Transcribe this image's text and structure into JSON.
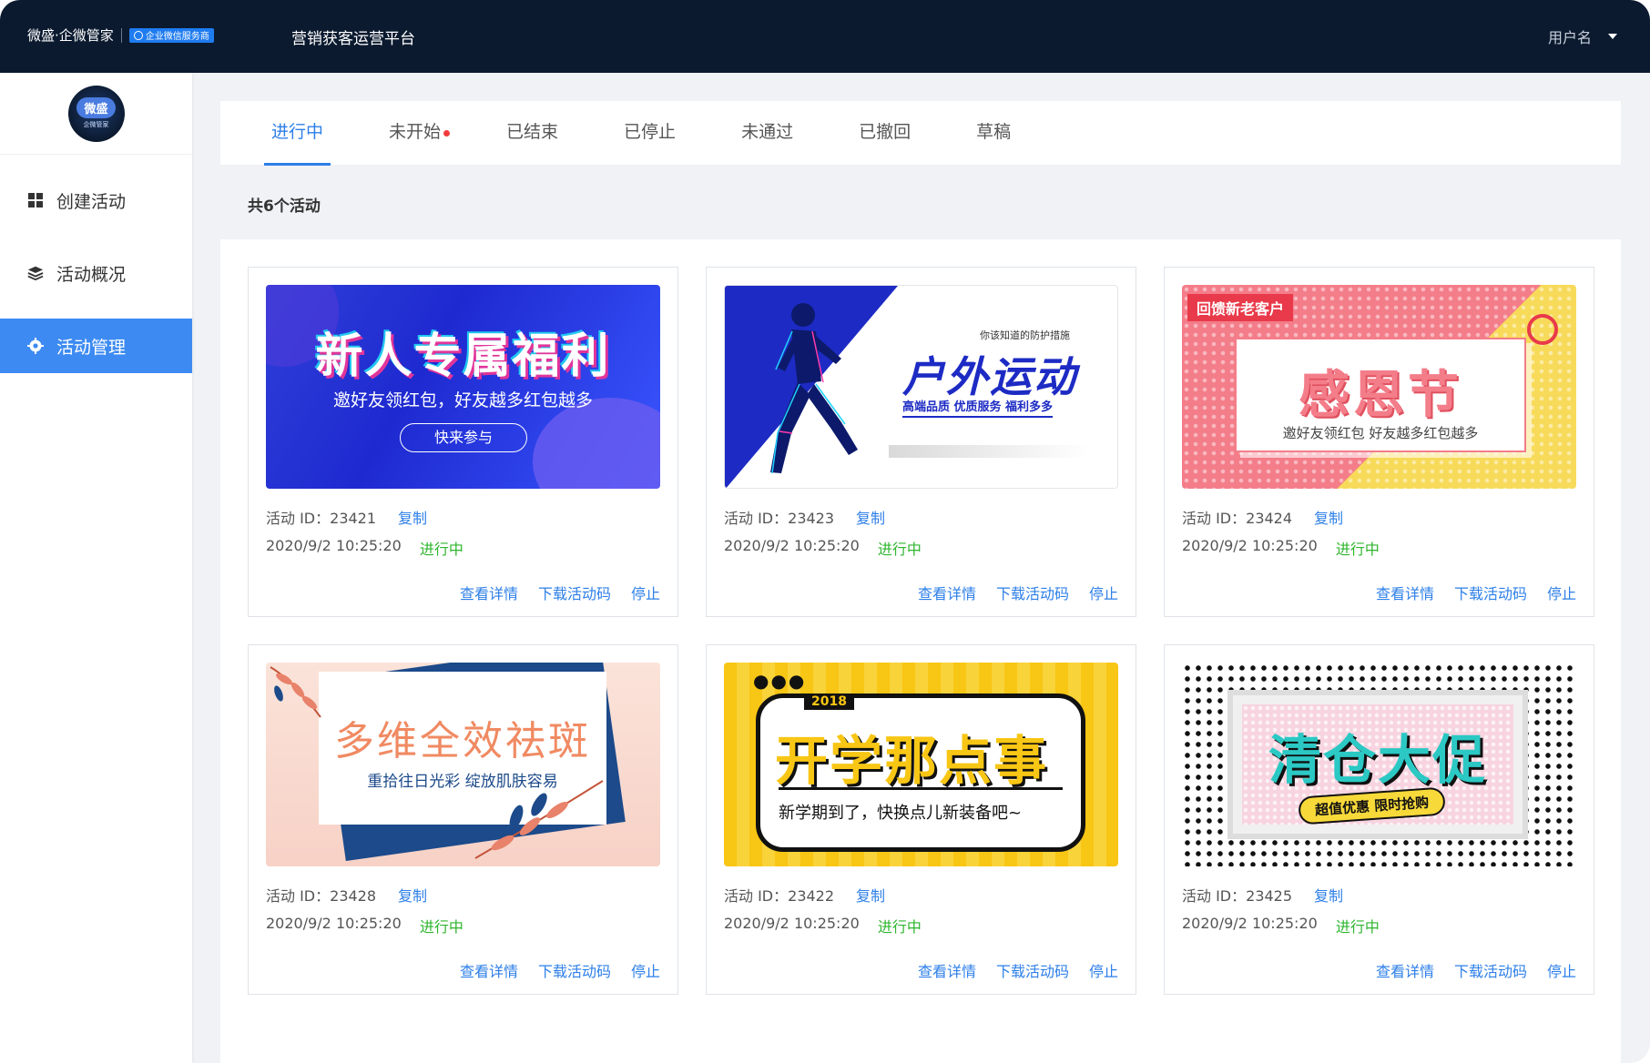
{
  "header": {
    "brand": "微盛·企微管家",
    "badge": "企业微信服务商",
    "platform_title": "营销获客运营平台",
    "user_name": "用户名"
  },
  "sidebar": {
    "logo_text": "微盛",
    "logo_sub": "企微管家",
    "items": [
      {
        "label": "创建活动",
        "icon": "grid-icon",
        "active": false
      },
      {
        "label": "活动概况",
        "icon": "layers-icon",
        "active": false
      },
      {
        "label": "活动管理",
        "icon": "gear-icon",
        "active": true
      }
    ]
  },
  "tabs": [
    {
      "label": "进行中",
      "active": true,
      "dot": false
    },
    {
      "label": "未开始",
      "active": false,
      "dot": true
    },
    {
      "label": "已结束",
      "active": false,
      "dot": false
    },
    {
      "label": "已停止",
      "active": false,
      "dot": false
    },
    {
      "label": "未通过",
      "active": false,
      "dot": false
    },
    {
      "label": "已撤回",
      "active": false,
      "dot": false
    },
    {
      "label": "草稿",
      "active": false,
      "dot": false
    }
  ],
  "summary": "共6个活动",
  "card_labels": {
    "id_prefix": "活动 ID：",
    "copy": "复制",
    "view": "查看详情",
    "download": "下载活动码",
    "stop": "停止"
  },
  "cards": [
    {
      "id": "23421",
      "time": "2020/9/2 10:25:20",
      "status": "进行中",
      "banner": {
        "title": "新人专属福利",
        "subtitle": "邀好友领红包，好友越多红包越多",
        "button": "快来参与"
      }
    },
    {
      "id": "23423",
      "time": "2020/9/2 10:25:20",
      "status": "进行中",
      "banner": {
        "small": "你该知道的防护措施",
        "title": "户外运动",
        "subtitle": "高端品质 优质服务 福利多多"
      }
    },
    {
      "id": "23424",
      "time": "2020/9/2 10:25:20",
      "status": "进行中",
      "banner": {
        "tag": "回馈新老客户",
        "title": "感恩节",
        "subtitle": "邀好友领红包 好友越多红包越多"
      }
    },
    {
      "id": "23428",
      "time": "2020/9/2 10:25:20",
      "status": "进行中",
      "banner": {
        "title": "多维全效祛斑",
        "subtitle": "重拾往日光彩 绽放肌肤容易"
      }
    },
    {
      "id": "23422",
      "time": "2020/9/2 10:25:20",
      "status": "进行中",
      "banner": {
        "year": "2018",
        "title": "开学那点事",
        "subtitle": "新学期到了，快换点儿新装备吧~"
      }
    },
    {
      "id": "23425",
      "time": "2020/9/2 10:25:20",
      "status": "进行中",
      "banner": {
        "title": "清仓大促",
        "subtitle": "超值优惠 限时抢购"
      }
    }
  ],
  "colors": {
    "topbar": "#0b1a2f",
    "accent": "#2d7fe8",
    "active_nav": "#3d8bf2",
    "status_green": "#2fb52f",
    "tab_dot": "#f23c3c"
  }
}
